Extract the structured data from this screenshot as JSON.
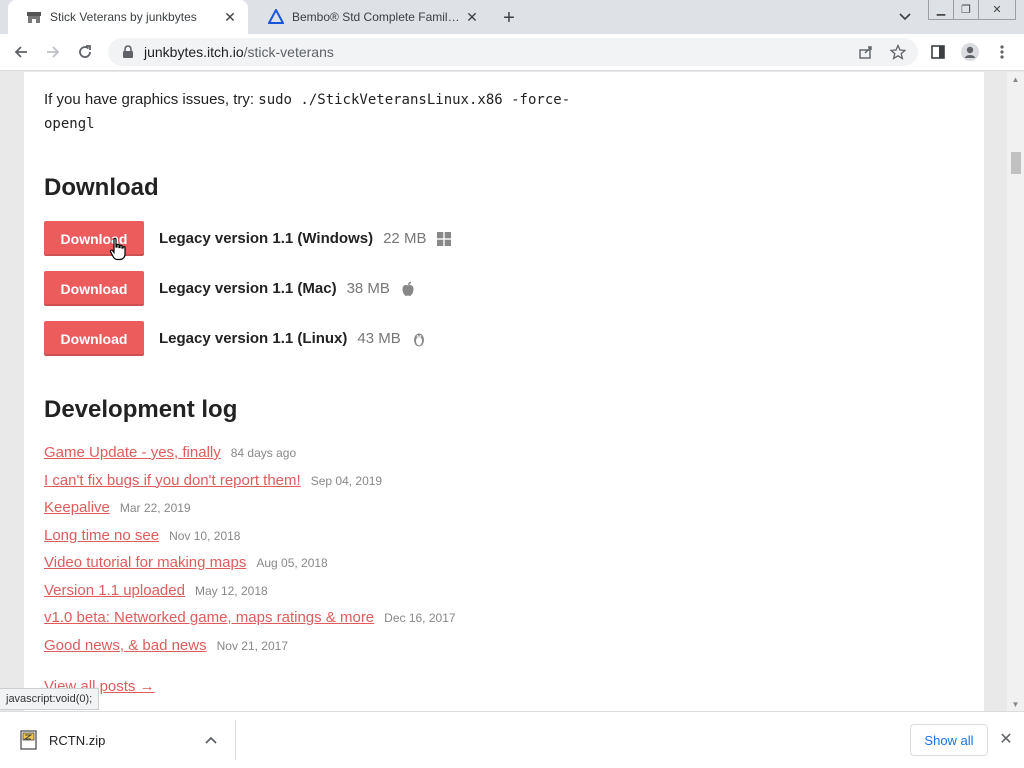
{
  "browser": {
    "tabs": [
      {
        "title": "Stick Veterans by junkbytes",
        "active": true,
        "favicon": "itchio-icon"
      },
      {
        "title": "Bembo® Std Complete Family Pa",
        "active": false,
        "favicon": "monotype-icon"
      }
    ],
    "url_host": "junkbytes.itch.io",
    "url_path": "/stick-veterans"
  },
  "page": {
    "note_prefix": "If you have graphics issues, try: ",
    "note_code": "sudo ./StickVeteransLinux.x86 -force-opengl",
    "download_heading": "Download",
    "downloads": [
      {
        "button": "Download",
        "name": "Legacy version 1.1 (Windows)",
        "size": "22 MB",
        "os_icon": "windows-icon"
      },
      {
        "button": "Download",
        "name": "Legacy version 1.1 (Mac)",
        "size": "38 MB",
        "os_icon": "apple-icon"
      },
      {
        "button": "Download",
        "name": "Legacy version 1.1 (Linux)",
        "size": "43 MB",
        "os_icon": "linux-icon"
      }
    ],
    "devlog_heading": "Development log",
    "posts": [
      {
        "title": "Game Update - yes, finally",
        "date": "84 days ago"
      },
      {
        "title": "I can't fix bugs if you don't report them!",
        "date": "Sep 04, 2019"
      },
      {
        "title": "Keepalive",
        "date": "Mar 22, 2019"
      },
      {
        "title": "Long time no see",
        "date": "Nov 10, 2018"
      },
      {
        "title": "Video tutorial for making maps",
        "date": "Aug 05, 2018"
      },
      {
        "title": "Version 1.1 uploaded",
        "date": "May 12, 2018"
      },
      {
        "title": "v1.0 beta: Networked game, maps ratings & more",
        "date": "Dec 16, 2017"
      },
      {
        "title": "Good news, & bad news",
        "date": "Nov 21, 2017"
      }
    ],
    "view_all": "View all posts →"
  },
  "status_bar": "javascript:void(0);",
  "shelf": {
    "file_name": "RCTN.zip",
    "show_all": "Show all"
  },
  "colors": {
    "accent": "#ec5c5c",
    "link": "#de5c5c"
  }
}
